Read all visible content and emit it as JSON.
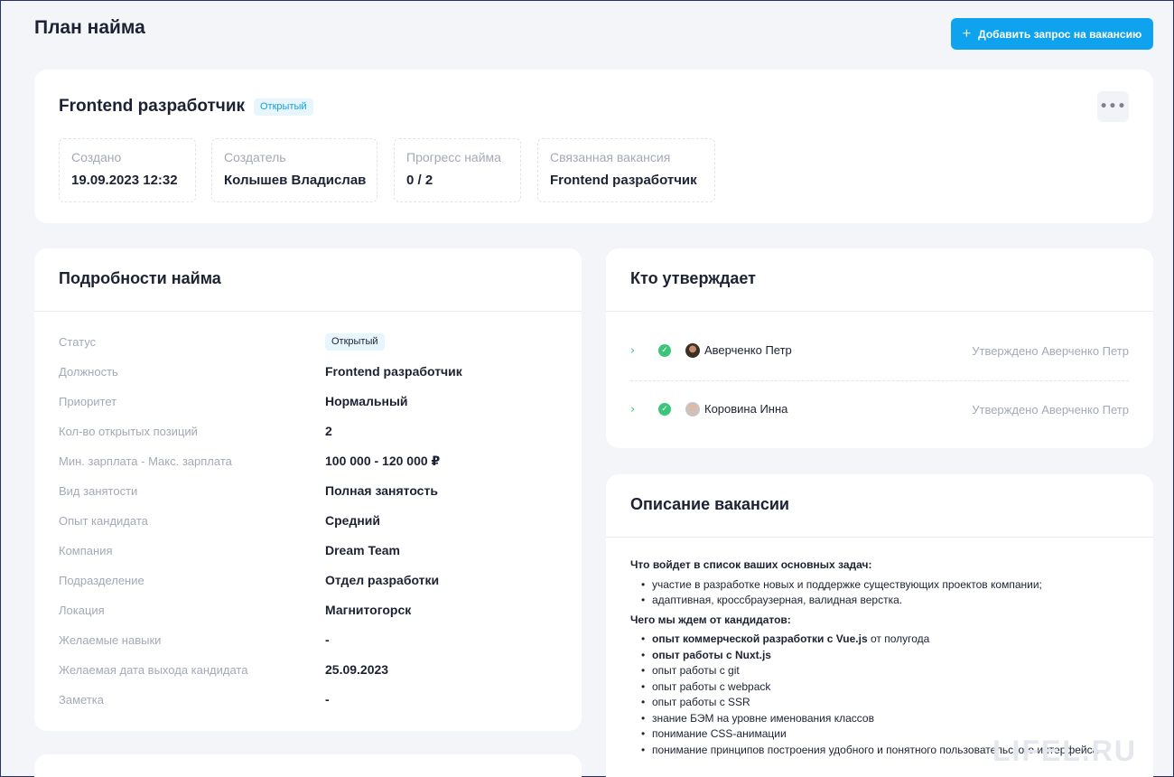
{
  "header": {
    "title": "План найма",
    "add_button": "Добавить запрос на вакансию"
  },
  "vacancy": {
    "title": "Frontend разработчик",
    "status": "Открытый",
    "info": [
      {
        "label": "Создано",
        "value": "19.09.2023 12:32"
      },
      {
        "label": "Создатель",
        "value": "Колышев Владислав"
      },
      {
        "label": "Прогресс найма",
        "value": "0 / 2"
      },
      {
        "label": "Связанная вакансия",
        "value": "Frontend разработчик"
      }
    ]
  },
  "details": {
    "title": "Подробности найма",
    "rows": [
      {
        "label": "Статус",
        "value": "Открытый"
      },
      {
        "label": "Должность",
        "value": "Frontend разработчик"
      },
      {
        "label": "Приоритет",
        "value": "Нормальный"
      },
      {
        "label": "Кол-во открытых позиций",
        "value": "2"
      },
      {
        "label": "Мин. зарплата - Макс. зарплата",
        "value": "100 000 - 120 000 ₽"
      },
      {
        "label": "Вид занятости",
        "value": "Полная занятость"
      },
      {
        "label": "Опыт кандидата",
        "value": "Средний"
      },
      {
        "label": "Компания",
        "value": "Dream Team"
      },
      {
        "label": "Подразделение",
        "value": "Отдел разработки"
      },
      {
        "label": "Локация",
        "value": "Магнитогорск"
      },
      {
        "label": "Желаемые навыки",
        "value": "-"
      },
      {
        "label": "Желаемая дата выхода кандидата",
        "value": "25.09.2023"
      },
      {
        "label": "Заметка",
        "value": "-"
      }
    ]
  },
  "approvers": {
    "title": "Кто утверждает",
    "items": [
      {
        "name": "Аверченко Петр",
        "status": "Утверждено Аверченко Петр"
      },
      {
        "name": "Коровина Инна",
        "status": "Утверждено Аверченко Петр"
      }
    ]
  },
  "description": {
    "title": "Описание вакансии",
    "tasks_heading": "Что войдет в список ваших основных задач:",
    "tasks": [
      "участие в разработке новых и поддержке существующих проектов компании;",
      "адаптивная, кроссбраузерная, валидная верстка."
    ],
    "expect_heading": "Чего мы ждем от кандидатов:",
    "expect": [
      {
        "bold": "опыт коммерческой разработки с Vue.js",
        "rest": " от полугода"
      },
      {
        "bold": "опыт работы с Nuxt.js",
        "rest": ""
      },
      {
        "bold": "",
        "rest": "опыт работы с git"
      },
      {
        "bold": "",
        "rest": "опыт работы с webpack"
      },
      {
        "bold": "",
        "rest": "опыт работы с SSR"
      },
      {
        "bold": "",
        "rest": "знание БЭМ на уровне именования классов"
      },
      {
        "bold": "",
        "rest": "понимание CSS-анимации"
      },
      {
        "bold": "",
        "rest": "понимание принципов построения удобного и понятного пользовательского интерфейса"
      }
    ]
  },
  "watermark": "LIFEL.RU",
  "colors": {
    "accent": "#0fa3ef",
    "success": "#3cc57a",
    "background": "#f3f5f9"
  }
}
